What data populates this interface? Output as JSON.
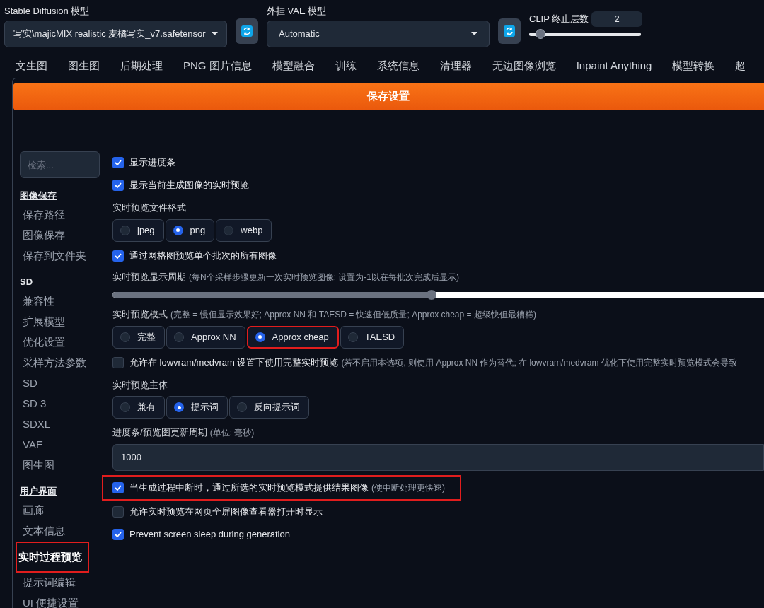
{
  "header": {
    "model": {
      "label": "Stable Diffusion 模型",
      "value": "写实\\majicMIX realistic 麦橘写实_v7.safetensor"
    },
    "vae": {
      "label": "外挂 VAE 模型",
      "value": "Automatic"
    },
    "clip": {
      "label": "CLIP 终止层数",
      "value": "2",
      "level": 0.1
    }
  },
  "tabs": [
    {
      "label": "文生图"
    },
    {
      "label": "图生图"
    },
    {
      "label": "后期处理"
    },
    {
      "label": "PNG 图片信息"
    },
    {
      "label": "模型融合"
    },
    {
      "label": "训练"
    },
    {
      "label": "系统信息"
    },
    {
      "label": "清理器"
    },
    {
      "label": "无边图像浏览"
    },
    {
      "label": "Inpaint Anything"
    },
    {
      "label": "模型转换"
    },
    {
      "label": "超"
    }
  ],
  "save_button": "保存设置",
  "sidebar": {
    "search_placeholder": "检索...",
    "sections": [
      {
        "title": "图像保存",
        "items": [
          {
            "label": "保存路径",
            "selected": false,
            "highlighted": false
          },
          {
            "label": "图像保存",
            "selected": false,
            "highlighted": false
          },
          {
            "label": "保存到文件夹",
            "selected": false,
            "highlighted": false
          }
        ]
      },
      {
        "title": "SD",
        "items": [
          {
            "label": "兼容性",
            "selected": false,
            "highlighted": false
          },
          {
            "label": "扩展模型",
            "selected": false,
            "highlighted": false
          },
          {
            "label": "优化设置",
            "selected": false,
            "highlighted": false
          },
          {
            "label": "采样方法参数",
            "selected": false,
            "highlighted": false
          },
          {
            "label": "SD",
            "selected": false,
            "highlighted": false
          },
          {
            "label": "SD 3",
            "selected": false,
            "highlighted": false
          },
          {
            "label": "SDXL",
            "selected": false,
            "highlighted": false
          },
          {
            "label": "VAE",
            "selected": false,
            "highlighted": false
          },
          {
            "label": "图生图",
            "selected": false,
            "highlighted": false
          }
        ]
      },
      {
        "title": "用户界面",
        "items": [
          {
            "label": "画廊",
            "selected": false,
            "highlighted": false
          },
          {
            "label": "文本信息",
            "selected": false,
            "highlighted": false
          },
          {
            "label": "实时过程预览",
            "selected": true,
            "highlighted": true
          },
          {
            "label": "提示词编辑",
            "selected": false,
            "highlighted": false
          },
          {
            "label": "UI 便捷设置",
            "selected": false,
            "highlighted": false
          }
        ]
      }
    ]
  },
  "settings": [
    {
      "kind": "checkbox",
      "label": "显示进度条",
      "checked": true,
      "highlighted": false
    },
    {
      "kind": "checkbox",
      "label": "显示当前生成图像的实时预览",
      "checked": true,
      "highlighted": false
    },
    {
      "kind": "radio",
      "label": "实时预览文件格式",
      "options": [
        {
          "label": "jpeg",
          "selected": false,
          "highlighted": false
        },
        {
          "label": "png",
          "selected": true,
          "highlighted": false
        },
        {
          "label": "webp",
          "selected": false,
          "highlighted": false
        }
      ]
    },
    {
      "kind": "checkbox",
      "label": "通过网格图预览单个批次的所有图像",
      "checked": true,
      "highlighted": false
    },
    {
      "kind": "slider",
      "label": "实时预览显示周期",
      "note": "(每N个采样步骤更新一次实时预览图像; 设置为-1以在每批次完成后显示)",
      "level": 0.49
    },
    {
      "kind": "radio",
      "label": "实时预览模式",
      "note": "(完整 = 慢但显示效果好; Approx NN 和 TAESD = 快速但低质量; Approx cheap = 超级快但最糟糕)",
      "options": [
        {
          "label": "完整",
          "selected": false,
          "highlighted": false
        },
        {
          "label": "Approx NN",
          "selected": false,
          "highlighted": false
        },
        {
          "label": "Approx cheap",
          "selected": true,
          "highlighted": true
        },
        {
          "label": "TAESD",
          "selected": false,
          "highlighted": false
        }
      ]
    },
    {
      "kind": "checkbox",
      "label": "允许在 lowvram/medvram 设置下使用完整实时预览",
      "note": "(若不启用本选项, 则使用 Approx NN 作为替代; 在 lowvram/medvram 优化下使用完整实时预览模式会导致",
      "checked": false,
      "highlighted": false
    },
    {
      "kind": "radio",
      "label": "实时预览主体",
      "options": [
        {
          "label": "兼有",
          "selected": false,
          "highlighted": false
        },
        {
          "label": "提示词",
          "selected": true,
          "highlighted": false
        },
        {
          "label": "反向提示词",
          "selected": false,
          "highlighted": false
        }
      ]
    },
    {
      "kind": "number",
      "label": "进度条/预览图更新周期",
      "note": "(单位: 毫秒)",
      "value": "1000"
    },
    {
      "kind": "checkbox",
      "label": "当生成过程中断时，通过所选的实时预览模式提供结果图像",
      "note": "(使中断处理更快速)",
      "checked": true,
      "highlighted": true
    },
    {
      "kind": "checkbox",
      "label": "允许实时预览在网页全屏图像查看器打开时显示",
      "checked": false,
      "highlighted": false
    },
    {
      "kind": "checkbox",
      "label": "Prevent screen sleep during generation",
      "checked": true,
      "highlighted": false
    }
  ]
}
